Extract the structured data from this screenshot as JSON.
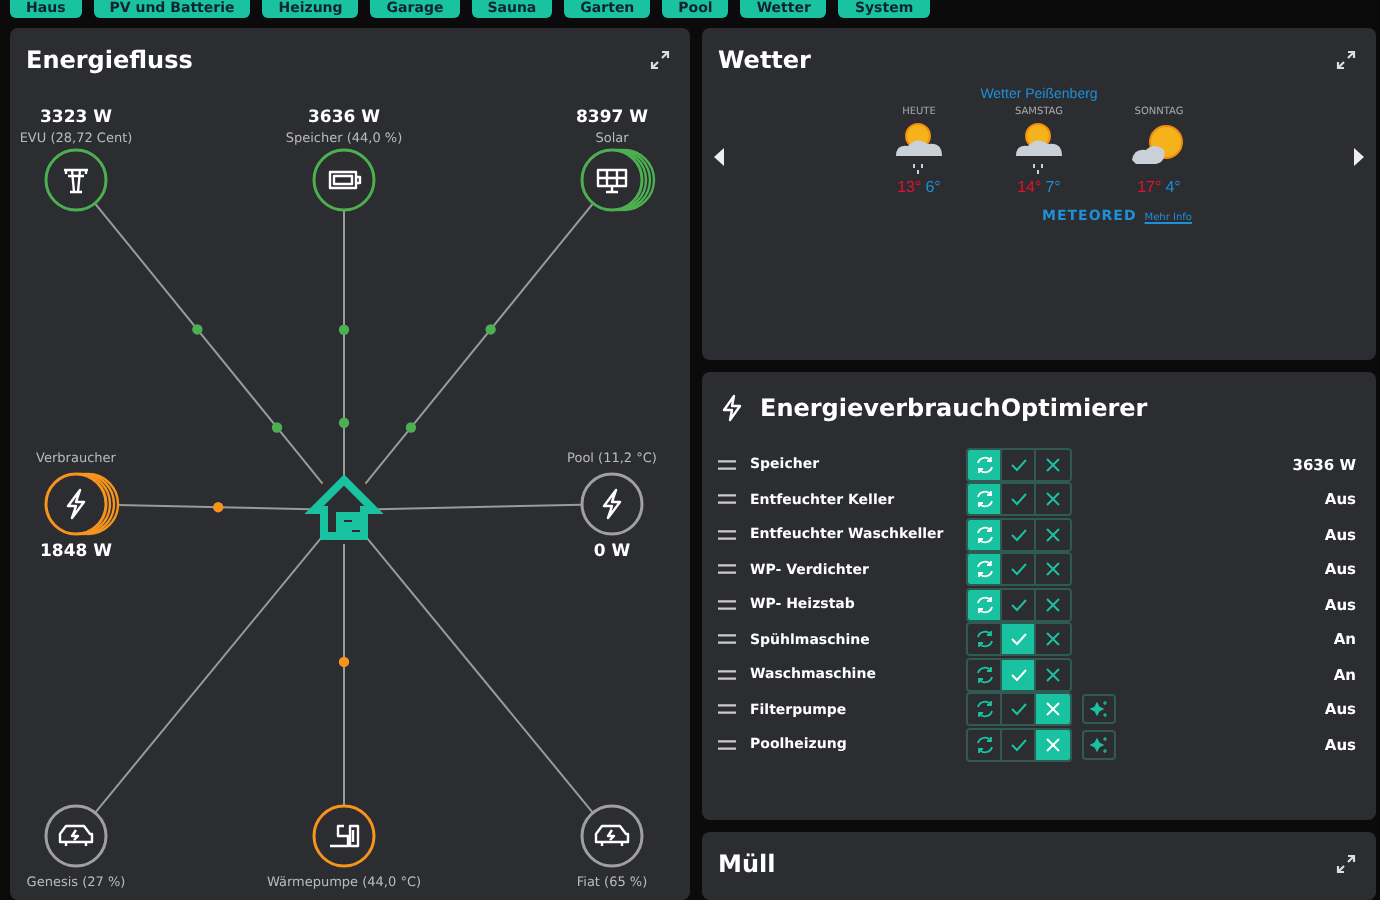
{
  "nav": [
    {
      "label": "Haus"
    },
    {
      "label": "PV und Batterie"
    },
    {
      "label": "Heizung"
    },
    {
      "label": "Garage"
    },
    {
      "label": "Sauna"
    },
    {
      "label": "Garten"
    },
    {
      "label": "Pool"
    },
    {
      "label": "Wetter"
    },
    {
      "label": "System"
    }
  ],
  "energy_flow": {
    "title": "Energiefluss",
    "nodes": [
      {
        "kind": "grid",
        "label": "EVU (28,72 Cent)",
        "value": "3323 W",
        "color": "#4caf50",
        "stacked": false
      },
      {
        "kind": "battery",
        "label": "Speicher (44,0 %)",
        "value": "3636 W",
        "color": "#4caf50",
        "stacked": false
      },
      {
        "kind": "solar",
        "label": "Solar",
        "value": "8397 W",
        "color": "#4caf50",
        "stacked": true
      },
      {
        "kind": "consumer",
        "label": "Verbraucher",
        "value": "1848 W",
        "color": "#f7941d",
        "stacked": true
      },
      {
        "kind": "consumer",
        "label": "Pool (11,2 °C)",
        "value": "0 W",
        "color": "#a0a0a0",
        "stacked": false
      },
      {
        "kind": "car",
        "label": "Genesis (27 %)",
        "color": "#a0a0a0",
        "stacked": false
      },
      {
        "kind": "heatpump",
        "label": "Wärmepumpe (44,0 °C)",
        "color": "#f7941d",
        "stacked": false
      },
      {
        "kind": "car",
        "label": "Fiat (65 %)",
        "color": "#a0a0a0",
        "stacked": false
      }
    ]
  },
  "weather": {
    "title": "Wetter",
    "location": "Wetter Peißenberg",
    "days": [
      {
        "label": "HEUTE",
        "high": "13°",
        "low": "6°",
        "rain": true
      },
      {
        "label": "SAMSTAG",
        "high": "14°",
        "low": "7°",
        "rain": true
      },
      {
        "label": "SONNTAG",
        "high": "17°",
        "low": "4°",
        "rain": false
      }
    ],
    "provider": "METEORED",
    "link": "Mehr Info"
  },
  "optimizer": {
    "title": "EnergieverbrauchOptimierer",
    "rows": [
      {
        "name": "Speicher",
        "modes": [
          {
            "kind": "auto",
            "selected": true
          },
          {
            "kind": "on",
            "selected": false
          },
          {
            "kind": "off",
            "selected": false
          }
        ],
        "extra": false,
        "status": "3636 W"
      },
      {
        "name": "Entfeuchter Keller",
        "modes": [
          {
            "kind": "auto",
            "selected": true
          },
          {
            "kind": "on",
            "selected": false
          },
          {
            "kind": "off",
            "selected": false
          }
        ],
        "extra": false,
        "status": "Aus"
      },
      {
        "name": "Entfeuchter Waschkeller",
        "modes": [
          {
            "kind": "auto",
            "selected": true
          },
          {
            "kind": "on",
            "selected": false
          },
          {
            "kind": "off",
            "selected": false
          }
        ],
        "extra": false,
        "status": "Aus"
      },
      {
        "name": "WP- Verdichter",
        "modes": [
          {
            "kind": "auto",
            "selected": true
          },
          {
            "kind": "on",
            "selected": false
          },
          {
            "kind": "off",
            "selected": false
          }
        ],
        "extra": false,
        "status": "Aus"
      },
      {
        "name": "WP- Heizstab",
        "modes": [
          {
            "kind": "auto",
            "selected": true
          },
          {
            "kind": "on",
            "selected": false
          },
          {
            "kind": "off",
            "selected": false
          }
        ],
        "extra": false,
        "status": "Aus"
      },
      {
        "name": "Spühlmaschine",
        "modes": [
          {
            "kind": "auto",
            "selected": false
          },
          {
            "kind": "on",
            "selected": true
          },
          {
            "kind": "off",
            "selected": false
          }
        ],
        "extra": false,
        "status": "An"
      },
      {
        "name": "Waschmaschine",
        "modes": [
          {
            "kind": "auto",
            "selected": false
          },
          {
            "kind": "on",
            "selected": true
          },
          {
            "kind": "off",
            "selected": false
          }
        ],
        "extra": false,
        "status": "An"
      },
      {
        "name": "Filterpumpe",
        "modes": [
          {
            "kind": "auto",
            "selected": false
          },
          {
            "kind": "on",
            "selected": false
          },
          {
            "kind": "off",
            "selected": true
          }
        ],
        "extra": true,
        "status": "Aus"
      },
      {
        "name": "Poolheizung",
        "modes": [
          {
            "kind": "auto",
            "selected": false
          },
          {
            "kind": "on",
            "selected": false
          },
          {
            "kind": "off",
            "selected": true
          }
        ],
        "extra": true,
        "status": "Aus"
      }
    ]
  },
  "waste": {
    "title": "Müll"
  }
}
